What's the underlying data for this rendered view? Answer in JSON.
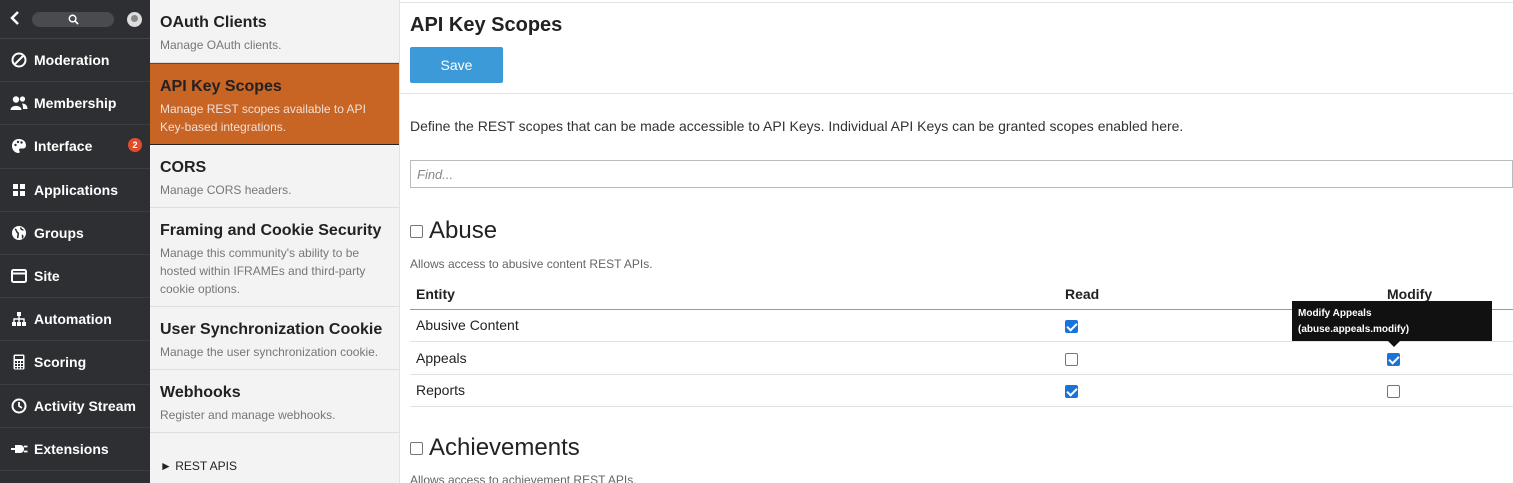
{
  "leftnav": {
    "back_icon": "chevron-left-icon",
    "search_icon": "search-icon",
    "avatar_icon": "user-avatar-icon",
    "items": [
      {
        "label": "Moderation",
        "icon": "ban-icon"
      },
      {
        "label": "Membership",
        "icon": "users-icon"
      },
      {
        "label": "Interface",
        "icon": "palette-icon",
        "badge": "2"
      },
      {
        "label": "Applications",
        "icon": "grid-icon"
      },
      {
        "label": "Groups",
        "icon": "globe-icon"
      },
      {
        "label": "Site",
        "icon": "window-icon"
      },
      {
        "label": "Automation",
        "icon": "sitemap-icon"
      },
      {
        "label": "Scoring",
        "icon": "calculator-icon"
      },
      {
        "label": "Activity Stream",
        "icon": "clock-icon"
      },
      {
        "label": "Extensions",
        "icon": "plug-icon"
      }
    ]
  },
  "subnav": {
    "items": [
      {
        "title": "OAuth Clients",
        "desc": "Manage OAuth clients."
      },
      {
        "title": "API Key Scopes",
        "desc": "Manage REST scopes available to API Key-based integrations.",
        "active": true
      },
      {
        "title": "CORS",
        "desc": "Manage CORS headers."
      },
      {
        "title": "Framing and Cookie Security",
        "desc": "Manage this community's ability to be hosted within IFRAMEs and third-party cookie options."
      },
      {
        "title": "User Synchronization Cookie",
        "desc": "Manage the user synchronization cookie."
      },
      {
        "title": "Webhooks",
        "desc": "Register and manage webhooks."
      }
    ],
    "rest_apis": "► REST APIS"
  },
  "main": {
    "title": "API Key Scopes",
    "save_label": "Save",
    "intro": "Define the REST scopes that can be made accessible to API Keys. Individual API Keys can be granted scopes enabled here.",
    "find_placeholder": "Find...",
    "sections": [
      {
        "name": "Abuse",
        "desc": "Allows access to abusive content REST APIs.",
        "checked": false,
        "columns": {
          "entity": "Entity",
          "read": "Read",
          "modify": "Modify"
        },
        "rows": [
          {
            "entity": "Abusive Content",
            "read": true,
            "modify": null
          },
          {
            "entity": "Appeals",
            "read": false,
            "modify": true
          },
          {
            "entity": "Reports",
            "read": true,
            "modify": false
          }
        ]
      },
      {
        "name": "Achievements",
        "desc": "Allows access to achievement REST APIs.",
        "checked": false
      }
    ],
    "tooltip": {
      "line1": "Modify Appeals",
      "line2": "(abuse.appeals.modify)"
    }
  },
  "colors": {
    "accent_orange": "#c86424",
    "save_blue": "#3d9ad9",
    "nav_dark": "#2e2f32",
    "checkbox_blue": "#1a73d8"
  }
}
